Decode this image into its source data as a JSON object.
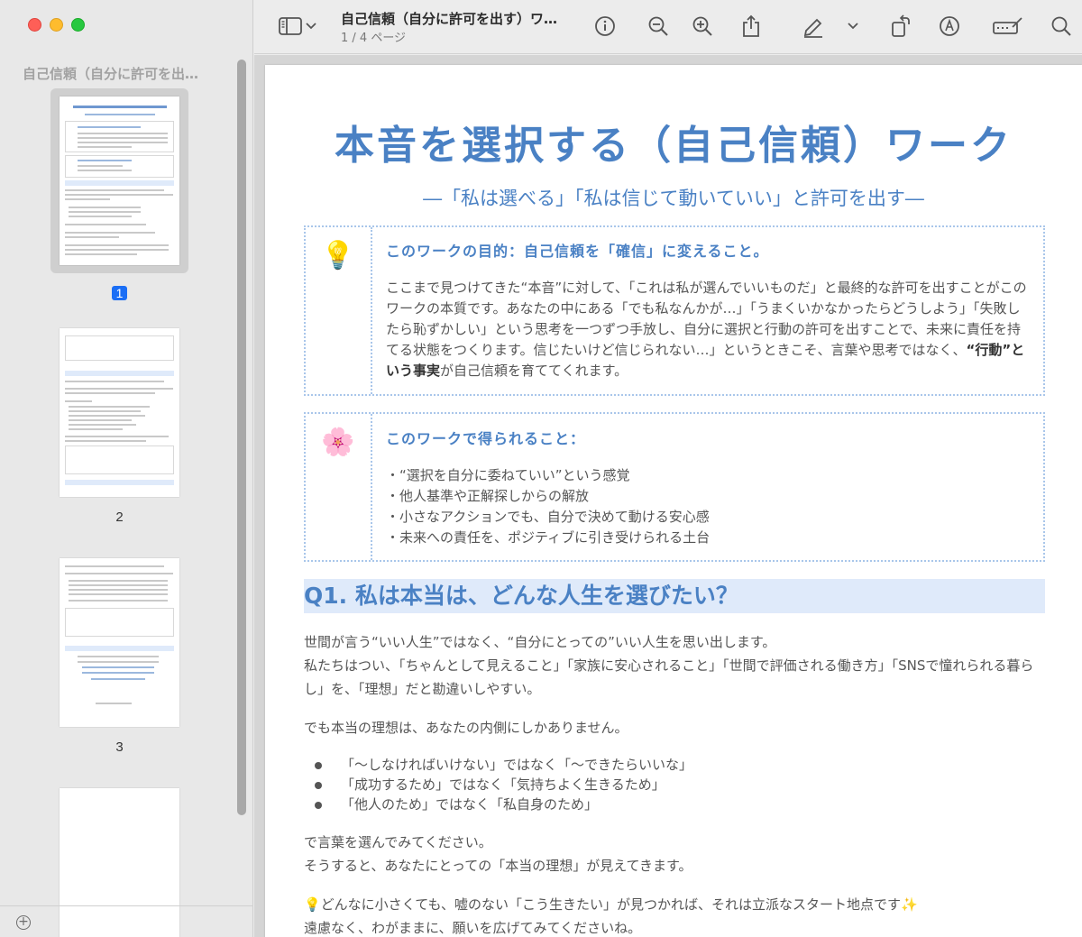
{
  "window": {
    "doc_title": "自己信頼（自分に許可を出す）ワ…",
    "page_info": "1 / 4 ページ"
  },
  "sidebar": {
    "title": "自己信頼（自分に許可を出…",
    "pages": [
      {
        "label": "1",
        "selected": true
      },
      {
        "label": "2",
        "selected": false
      },
      {
        "label": "3",
        "selected": false
      },
      {
        "label": "",
        "selected": false
      }
    ]
  },
  "toolbar": {
    "icons": [
      "sidebar-toggle-icon",
      "chevron-down-icon",
      "info-icon",
      "zoom-out-icon",
      "zoom-in-icon",
      "share-icon",
      "highlight-icon",
      "chevron-down-icon",
      "rotate-icon",
      "markup-icon",
      "redact-icon",
      "search-icon"
    ]
  },
  "document": {
    "title": "本音を選択する（自己信頼）ワーク",
    "subtitle": "―「私は選べる」「私は信じて動いていい」と許可を出す―",
    "box1": {
      "icon": "💡",
      "heading": "このワークの目的：自己信頼を「確信」に変えること。",
      "body_a": "ここまで見つけてきた“本音”に対して、「これは私が選んでいいものだ」と最終的な許可を出すことがこのワークの本質です。あなたの中にある「でも私なんかが…」「うまくいかなかったらどうしよう」「失敗したら恥ずかしい」という思考を一つずつ手放し、自分に選択と行動の許可を出すことで、未来に責任を持てる状態をつくります。信じたいけど信じられない…」というときこそ、言葉や思考ではなく、",
      "body_bold": "“行動”という事実",
      "body_b": "が自己信頼を育ててくれます。"
    },
    "box2": {
      "icon": "🌸",
      "heading": "このワークで得られること：",
      "items": [
        "・“選択を自分に委ねていい”という感覚",
        "・他人基準や正解探しからの解放",
        "・小さなアクションでも、自分で決めて動ける安心感",
        "・未来への責任を、ポジティブに引き受けられる土台"
      ]
    },
    "q1_heading": "Q1. 私は本当は、どんな人生を選びたい？",
    "q1_p1_line1": "世間が言う“いい人生”ではなく、“自分にとっての”いい人生を思い出します。",
    "q1_p1_line2": "私たちはつい、「ちゃんとして見えること」「家族に安心されること」「世間で評価される働き方」「SNSで憧れられる暮らし」を、「理想」だと勘違いしやすい。",
    "q1_p2": "でも本当の理想は、あなたの内側にしかありません。",
    "q1_bullets": [
      "「〜しなければいけない」ではなく「〜できたらいいな」",
      "「成功するため」ではなく「気持ちよく生きるため」",
      "「他人のため」ではなく「私自身のため」"
    ],
    "q1_p3_line1": "で言葉を選んでみてください。",
    "q1_p3_line2": " そうすると、あなたにとっての「本当の理想」が見えてきます。",
    "q1_p4_line1": "💡どんなに小さくても、嘘のない「こう生きたい」が見つかれば、それは立派なスタート地点です✨",
    "q1_p4_line2": " 遠慮なく、わがままに、願いを広げてみてくださいね。"
  }
}
